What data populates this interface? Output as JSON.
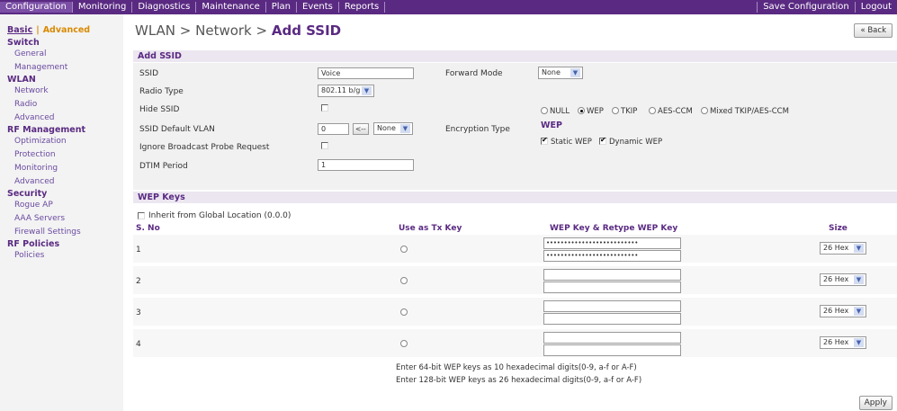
{
  "topnav": {
    "items": [
      "Configuration",
      "Monitoring",
      "Diagnostics",
      "Maintenance",
      "Plan",
      "Events",
      "Reports"
    ],
    "right": [
      "Save Configuration",
      "Logout"
    ]
  },
  "sidebar": {
    "basic": "Basic",
    "separator": "|",
    "advanced": "Advanced",
    "switch": {
      "title": "Switch",
      "items": [
        "General",
        "Management"
      ]
    },
    "wlan": {
      "title": "WLAN",
      "items": [
        "Network",
        "Radio",
        "Advanced"
      ]
    },
    "rf": {
      "title": "RF Management",
      "items": [
        "Optimization",
        "Protection",
        "Monitoring",
        "Advanced"
      ]
    },
    "security": {
      "title": "Security",
      "items": [
        "Rogue AP",
        "AAA Servers",
        "Firewall Settings"
      ]
    },
    "rfpol": {
      "title": "RF Policies",
      "items": [
        "Policies"
      ]
    }
  },
  "header": {
    "breadcrumb": "WLAN > Network > ",
    "current": "Add SSID",
    "back": "« Back"
  },
  "add_ssid": {
    "title": "Add SSID",
    "ssid_label": "SSID",
    "ssid_value": "Voice",
    "radio_type_label": "Radio Type",
    "radio_type_value": "802.11 b/g",
    "hide_ssid_label": "Hide SSID",
    "vlan_label": "SSID Default VLAN",
    "vlan_value": "0",
    "vlan_arrow_btn": "<--",
    "vlan_select": "None",
    "ignore_label": "Ignore Broadcast Probe Request",
    "dtim_label": "DTIM Period",
    "dtim_value": "1",
    "forward_mode_label": "Forward Mode",
    "forward_mode_value": "None",
    "encryption_label": "Encryption Type",
    "enc_options": [
      "NULL",
      "WEP",
      "TKIP",
      "AES-CCM",
      "Mixed TKIP/AES-CCM"
    ],
    "wep_heading": "WEP",
    "static_wep": "Static WEP",
    "dynamic_wep": "Dynamic WEP"
  },
  "wep_keys": {
    "title": "WEP Keys",
    "inherit_label": "Inherit from Global Location (0.0.0)",
    "col_sno": "S. No",
    "col_tx": "Use as Tx Key",
    "col_key": "WEP Key & Retype WEP Key",
    "col_size": "Size",
    "rows": [
      {
        "no": "1",
        "key1": "••••••••••••••••••••••••••",
        "key2": "••••••••••••••••••••••••••",
        "size": "26 Hex"
      },
      {
        "no": "2",
        "key1": "",
        "key2": "",
        "size": "26 Hex"
      },
      {
        "no": "3",
        "key1": "",
        "key2": "",
        "size": "26 Hex"
      },
      {
        "no": "4",
        "key1": "",
        "key2": "",
        "size": "26 Hex"
      }
    ],
    "hint64": "Enter 64-bit WEP keys as 10 hexadecimal digits(0-9, a-f or A-F)",
    "hint128": "Enter 128-bit WEP keys as 26 hexadecimal digits(0-9, a-f or A-F)"
  },
  "apply": "Apply",
  "colors": {
    "brand": "#5a2a82",
    "accent": "#d98a00"
  }
}
